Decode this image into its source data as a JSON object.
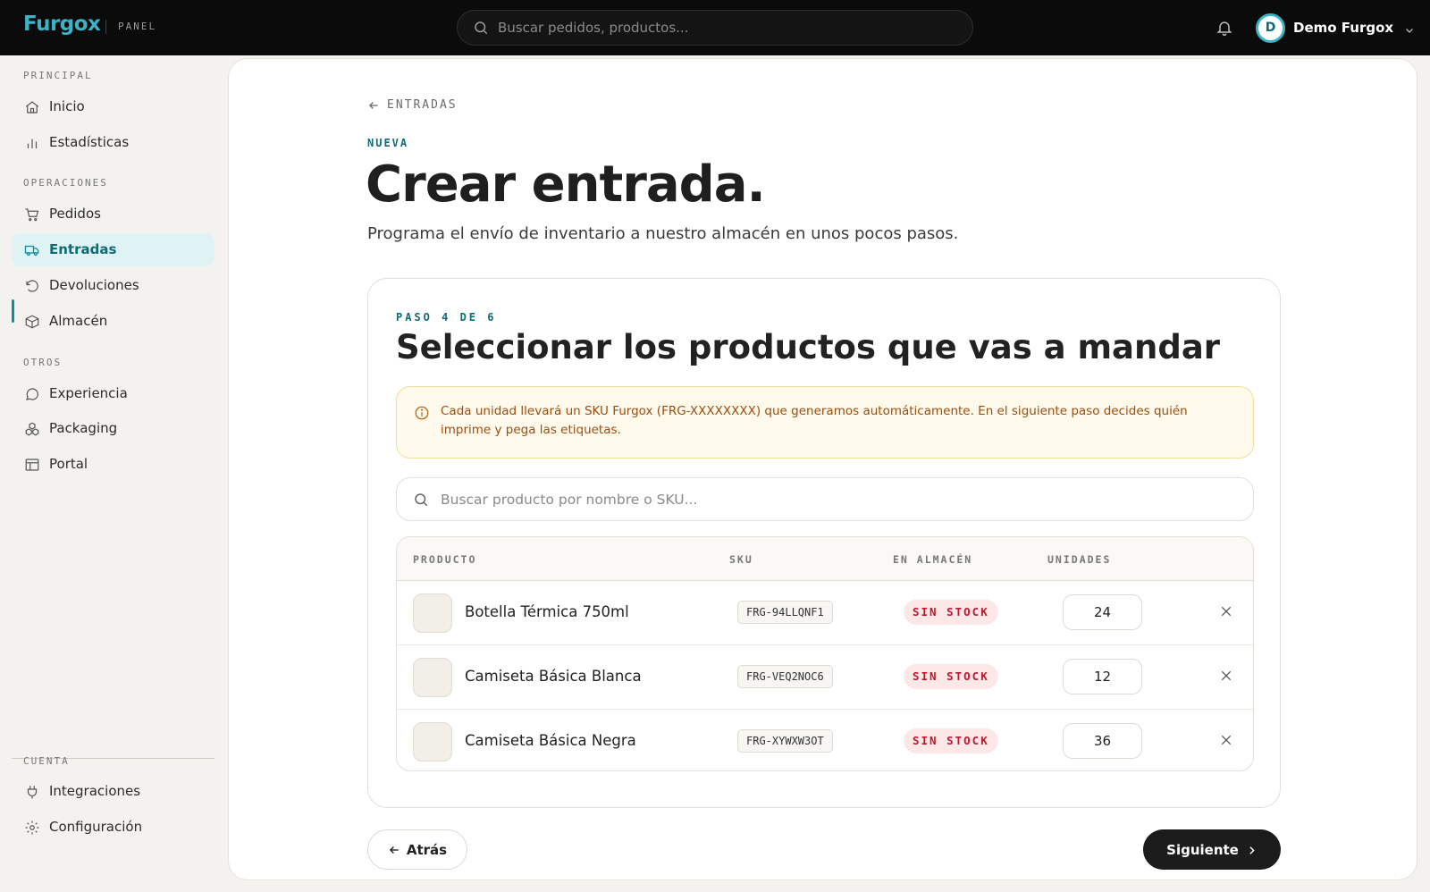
{
  "app": {
    "logo": "Furgox",
    "logo_sub": "PANEL",
    "search_placeholder": "Buscar pedidos, productos...",
    "user_initial": "D",
    "user_name": "Demo Furgox"
  },
  "sidebar": {
    "sections": [
      {
        "title": "PRINCIPAL",
        "items": [
          {
            "label": "Inicio",
            "icon": "home-icon"
          },
          {
            "label": "Estadísticas",
            "icon": "stats-icon"
          }
        ]
      },
      {
        "title": "OPERACIONES",
        "items": [
          {
            "label": "Pedidos",
            "icon": "cart-icon"
          },
          {
            "label": "Entradas",
            "icon": "truck-icon",
            "active": true
          },
          {
            "label": "Devoluciones",
            "icon": "return-icon"
          },
          {
            "label": "Almacén",
            "icon": "box-icon"
          }
        ]
      },
      {
        "title": "OTROS",
        "items": [
          {
            "label": "Experiencia",
            "icon": "chat-icon"
          },
          {
            "label": "Packaging",
            "icon": "packaging-icon"
          },
          {
            "label": "Portal",
            "icon": "portal-icon"
          }
        ]
      },
      {
        "title": "CUENTA",
        "items": [
          {
            "label": "Integraciones",
            "icon": "plug-icon"
          },
          {
            "label": "Configuración",
            "icon": "gear-icon"
          }
        ]
      }
    ]
  },
  "page": {
    "back_label": "ENTRADAS",
    "eyebrow": "NUEVA",
    "title": "Crear entrada.",
    "subtitle": "Programa el envío de inventario a nuestro almacén en unos pocos pasos."
  },
  "step": {
    "label": "PASO 4 DE 6",
    "title": "Seleccionar los productos que vas a mandar",
    "notice": "Cada unidad llevará un SKU Furgox (FRG-XXXXXXXX) que generamos automáticamente. En el siguiente paso decides quién imprime y pega las etiquetas.",
    "search_placeholder": "Buscar producto por nombre o SKU..."
  },
  "table": {
    "headers": {
      "product": "PRODUCTO",
      "sku": "SKU",
      "stock": "EN ALMACÉN",
      "units": "UNIDADES"
    },
    "rows": [
      {
        "name": "Botella Térmica 750ml",
        "sku": "FRG-94LLQNF1",
        "stock": "SIN STOCK",
        "units": "24"
      },
      {
        "name": "Camiseta Básica Blanca",
        "sku": "FRG-VEQ2NOC6",
        "stock": "SIN STOCK",
        "units": "12"
      },
      {
        "name": "Camiseta Básica Negra",
        "sku": "FRG-XYWXW3OT",
        "stock": "SIN STOCK",
        "units": "36"
      }
    ]
  },
  "actions": {
    "back": "Atrás",
    "next": "Siguiente"
  },
  "colors": {
    "accent": "#0e6b78",
    "brand": "#3bb3c4",
    "danger": "#c0162b",
    "notice_text": "#9a4d10"
  }
}
